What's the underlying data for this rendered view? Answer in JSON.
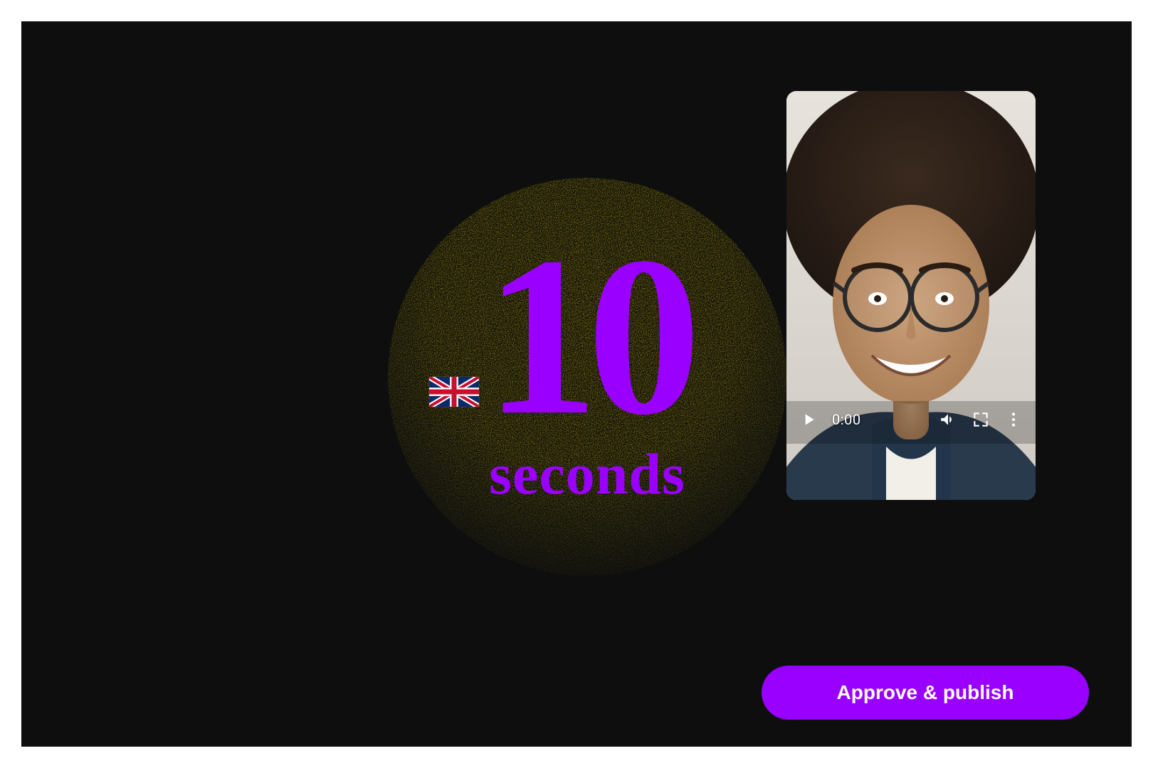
{
  "artwork": {
    "number_text": "10",
    "sub_text": "seconds",
    "flag_label": "uk-flag",
    "accent_color": "#9a00ff",
    "disc_color_top": "#f2d800",
    "disc_color_bottom": "rgba(242,216,0,0)"
  },
  "video": {
    "current_time": "0:00",
    "play_icon": "play-icon",
    "volume_icon": "volume-icon",
    "fullscreen_icon": "fullscreen-icon",
    "more_icon": "more-icon"
  },
  "actions": {
    "approve_label": "Approve & publish"
  }
}
